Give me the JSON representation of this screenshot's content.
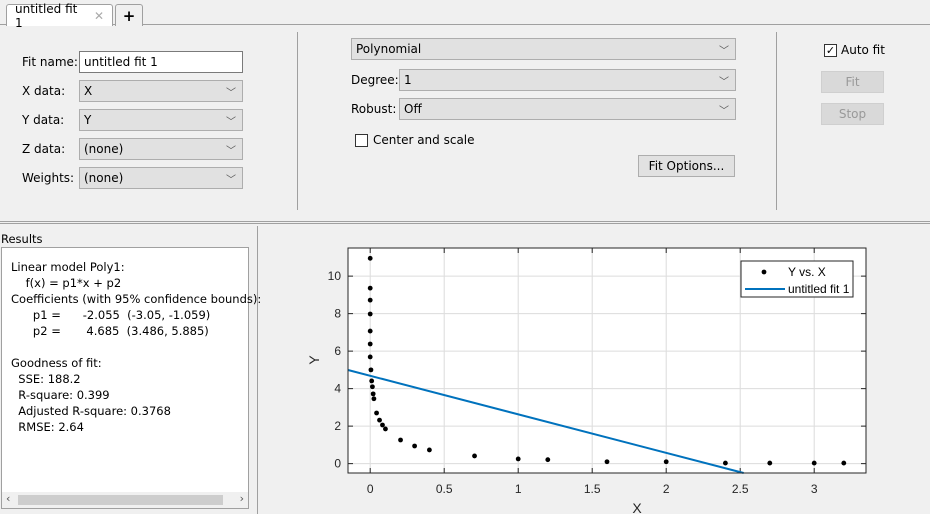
{
  "tabs": [
    {
      "label": "untitled fit 1",
      "close_icon": "close-icon"
    }
  ],
  "new_tab_label": "+",
  "fit_setup": {
    "fit_name_label": "Fit name:",
    "fit_name_value": "untitled fit 1",
    "x_data_label": "X data:",
    "x_data_value": "X",
    "y_data_label": "Y data:",
    "y_data_value": "Y",
    "z_data_label": "Z data:",
    "z_data_value": "(none)",
    "weights_label": "Weights:",
    "weights_value": "(none)"
  },
  "fit_type": {
    "model": "Polynomial",
    "degree_label": "Degree:",
    "degree_value": "1",
    "robust_label": "Robust:",
    "robust_value": "Off",
    "center_scale_label": "Center and scale",
    "center_scale_checked": false,
    "fit_options_label": "Fit Options..."
  },
  "actions": {
    "auto_fit_label": "Auto fit",
    "auto_fit_checked": true,
    "fit_label": "Fit",
    "stop_label": "Stop"
  },
  "results": {
    "title": "Results",
    "lines": [
      "Linear model Poly1:",
      "    f(x) = p1*x + p2",
      "Coefficients (with 95% confidence bounds):",
      "      p1 =      -2.055  (-3.05, -1.059)",
      "      p2 =       4.685  (3.486, 5.885)",
      "",
      "Goodness of fit:",
      "  SSE: 188.2",
      "  R-square: 0.399",
      "  Adjusted R-square: 0.3768",
      "  RMSE: 2.64"
    ]
  },
  "chart_data": {
    "type": "scatter",
    "xlabel": "X",
    "ylabel": "Y",
    "xlim": [
      -0.15,
      3.35
    ],
    "ylim": [
      -0.5,
      11.5
    ],
    "xticks": [
      0,
      0.5,
      1,
      1.5,
      2,
      2.5,
      3
    ],
    "xtick_labels": [
      "0",
      "0.5",
      "1",
      "1.5",
      "2",
      "2.5",
      "3"
    ],
    "yticks": [
      0,
      2,
      4,
      6,
      8,
      10
    ],
    "ytick_labels": [
      "0",
      "2",
      "4",
      "6",
      "8",
      "10"
    ],
    "grid": true,
    "legend_placement": "top-right",
    "series": [
      {
        "name": "Y vs. X",
        "kind": "points",
        "color": "#000000",
        "x": [
          0,
          0,
          0,
          0,
          0,
          0,
          0,
          0.005,
          0.01,
          0.015,
          0.02,
          0.025,
          0.043,
          0.063,
          0.083,
          0.103,
          0.205,
          0.3,
          0.4,
          0.705,
          1.0,
          1.2,
          1.6,
          2.0,
          2.4,
          2.7,
          3.0,
          3.2
        ],
        "y": [
          10.95,
          9.36,
          8.72,
          7.98,
          7.07,
          6.38,
          5.69,
          5.0,
          4.41,
          4.1,
          3.72,
          3.46,
          2.7,
          2.32,
          2.06,
          1.85,
          1.26,
          0.94,
          0.73,
          0.41,
          0.25,
          0.21,
          0.1,
          0.1,
          0.03,
          0.03,
          0.03,
          0.03
        ]
      },
      {
        "name": "untitled fit 1",
        "kind": "line",
        "color": "#0072bd",
        "slope": -2.055,
        "intercept": 4.685
      }
    ]
  }
}
